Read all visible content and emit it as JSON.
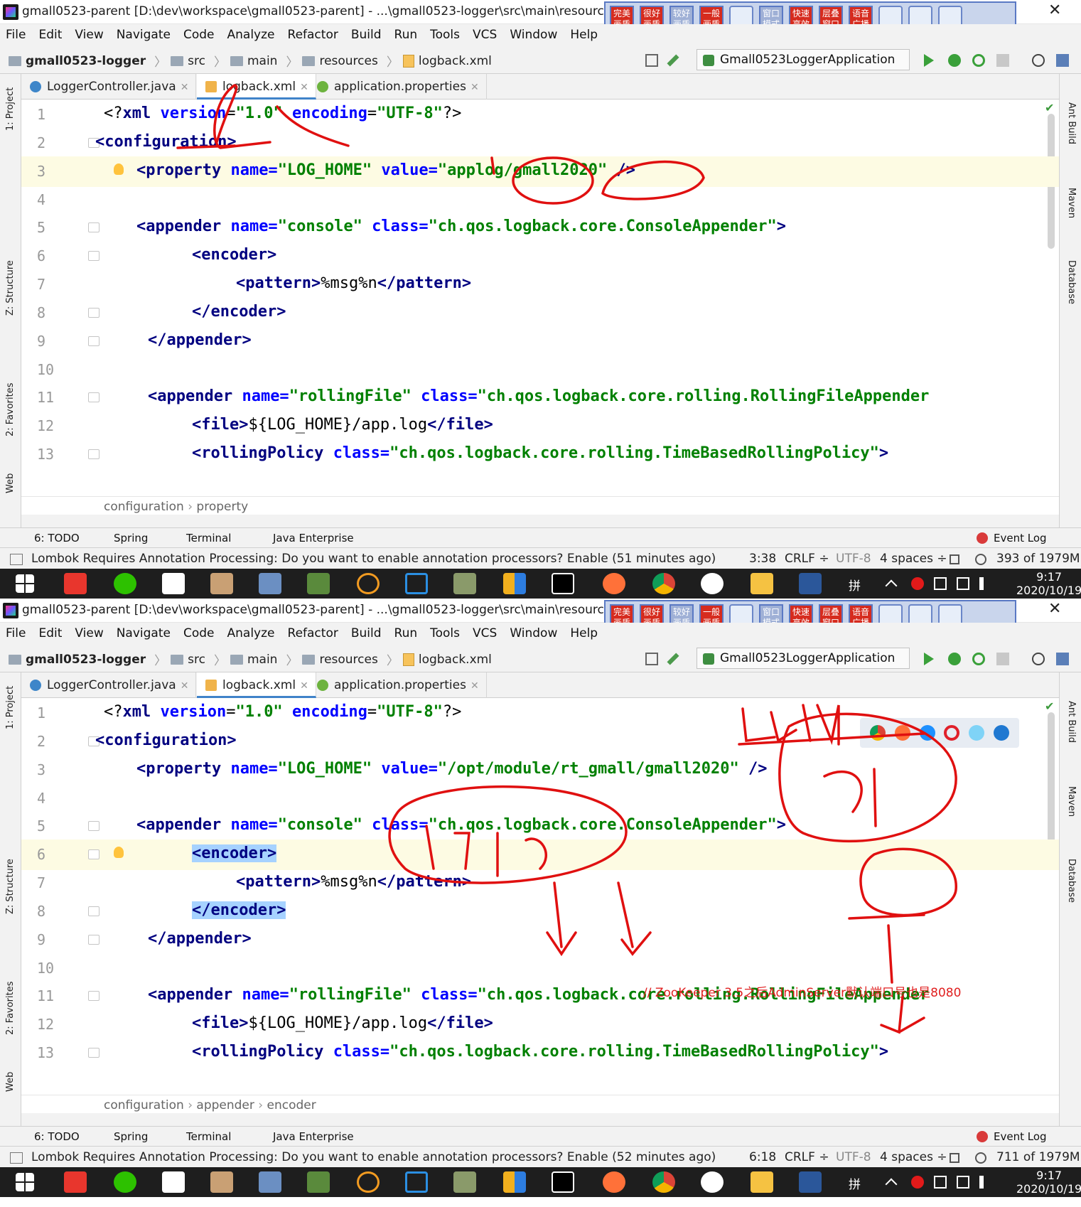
{
  "window": {
    "title": "gmall0523-parent [D:\\dev\\workspace\\gmall0523-parent] - ...\\gmall0523-logger\\src\\main\\resources\\lc",
    "close_glyph": "✕"
  },
  "ime_toolbar": {
    "buttons": [
      "完美\n画质",
      "很好\n画质",
      "较好\n画质",
      "一般\n画质",
      "窗口\n模式",
      "快速\n高效",
      "层叠\n窗口",
      "语音\n广播"
    ]
  },
  "menu": [
    "File",
    "Edit",
    "View",
    "Navigate",
    "Code",
    "Analyze",
    "Refactor",
    "Build",
    "Run",
    "Tools",
    "VCS",
    "Window",
    "Help"
  ],
  "breadcrumbs": [
    "gmall0523-logger",
    "src",
    "main",
    "resources",
    "logback.xml"
  ],
  "run_config": "Gmall0523LoggerApplication",
  "tabs": [
    "LoggerController.java",
    "logback.xml",
    "application.properties"
  ],
  "left_tool_labels": [
    "1: Project",
    "Z: Structure",
    "2: Favorites",
    "Web"
  ],
  "right_tool_labels": [
    "Ant Build",
    "Maven",
    "Database"
  ],
  "tool_windows": [
    "6: TODO",
    "Spring",
    "Terminal",
    "Java Enterprise",
    "Event Log"
  ],
  "status_message_a": "Lombok Requires Annotation Processing: Do you want to enable annotation processors? Enable (51 minutes ago)",
  "status_message_b": "Lombok Requires Annotation Processing: Do you want to enable annotation processors? Enable (52 minutes ago)",
  "status": {
    "a": {
      "pos": "3:38",
      "memory": "393 of 1979M"
    },
    "b": {
      "pos": "6:18",
      "memory": "711 of 1979M"
    },
    "crlf": "CRLF ÷",
    "encoding": "UTF-8",
    "indent": "4 spaces ÷"
  },
  "editor_crumbs": {
    "a": [
      "configuration",
      "property"
    ],
    "b": [
      "configuration",
      "appender",
      "encoder"
    ]
  },
  "code_a": {
    "l1": [
      "<?",
      "xml ",
      "version",
      "=",
      "\"1.0\"",
      " ",
      "encoding",
      "=",
      "\"UTF-8\"",
      "?>"
    ],
    "l3_value": "\"applog/gmall2020\""
  },
  "code_b": {
    "l3_value": "\"/opt/module/rt_gmall/gmall2020\""
  },
  "code_common": {
    "xml_decl": "<?xml version=\"1.0\" encoding=\"UTF-8\"?>",
    "configuration": "<configuration>",
    "property_open": "<property ",
    "property_name": "name=",
    "property_name_val": "\"LOG_HOME\"",
    "property_value": "value=",
    "property_close": " />",
    "appender_console_tag": "<appender ",
    "appender_console_name": "name=",
    "appender_console_name_val": "\"console\"",
    "appender_console_class": "class=",
    "appender_console_class_val": "\"ch.qos.logback.core.ConsoleAppender\"",
    "gt": ">",
    "encoder_open": "<encoder>",
    "pattern_open": "<pattern>",
    "pattern_text": "%msg%n",
    "pattern_close": "</pattern>",
    "encoder_close": "</encoder>",
    "appender_close": "</appender>",
    "appender_roll_name_val": "\"rollingFile\"",
    "appender_roll_class_val": "\"ch.qos.logback.core.rolling.RollingFileAppender",
    "file_open": "<file>",
    "file_text": "${LOG_HOME}/app.log",
    "file_close": "</file>",
    "rolling_tag": "<rollingPolicy ",
    "rolling_class_val": "\"ch.qos.logback.core.rolling.TimeBasedRollingPolicy\"",
    "line_numbers": [
      "1",
      "2",
      "3",
      "4",
      "5",
      "6",
      "7",
      "8",
      "9",
      "10",
      "11",
      "12",
      "13"
    ]
  },
  "annotation_note": "// ZooKeeper 3.5之后AdminServer默认端口号也是8080",
  "taskbar": {
    "ime_char": "拼",
    "time": "9:17",
    "date": "2020/10/19"
  },
  "colors": {
    "ide_bg": "#f2f2f2",
    "tag": "#000080",
    "attr": "#0000ff",
    "string": "#008000",
    "pen": "#e01010"
  }
}
